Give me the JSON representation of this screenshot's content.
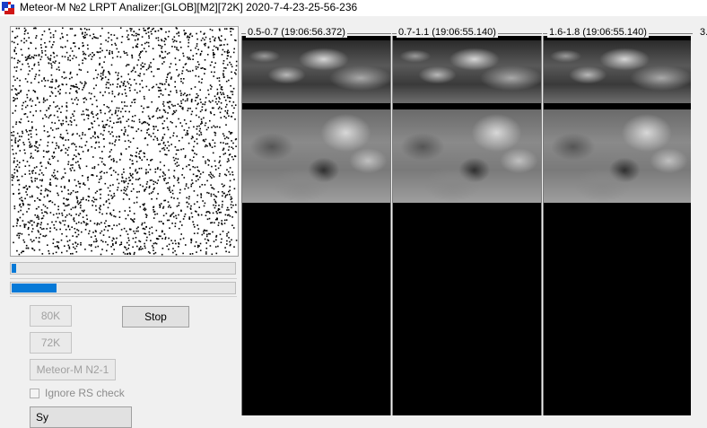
{
  "window": {
    "title": "Meteor-M №2 LRPT Analizer:[GLOB][M2][72K] 2020-7-4-23-25-56-236"
  },
  "progress": {
    "bar1": 0.02,
    "bar2": 0.2
  },
  "buttons": {
    "b80k": "80K",
    "stop": "Stop",
    "b72k": "72K",
    "satellite": "Meteor-M N2-1",
    "bottom": "Sy"
  },
  "checkbox": {
    "label": "Ignore RS check",
    "checked": false
  },
  "channels": [
    {
      "label": "0.5-0.7 (19:06:56.372)"
    },
    {
      "label": "0.7-1.1 (19:06:55.140)"
    },
    {
      "label": "1.6-1.8 (19:06:55.140)"
    },
    {
      "label": "3."
    }
  ],
  "colors": {
    "progress_fill": "#0679d7",
    "background": "#f0f0f0"
  }
}
